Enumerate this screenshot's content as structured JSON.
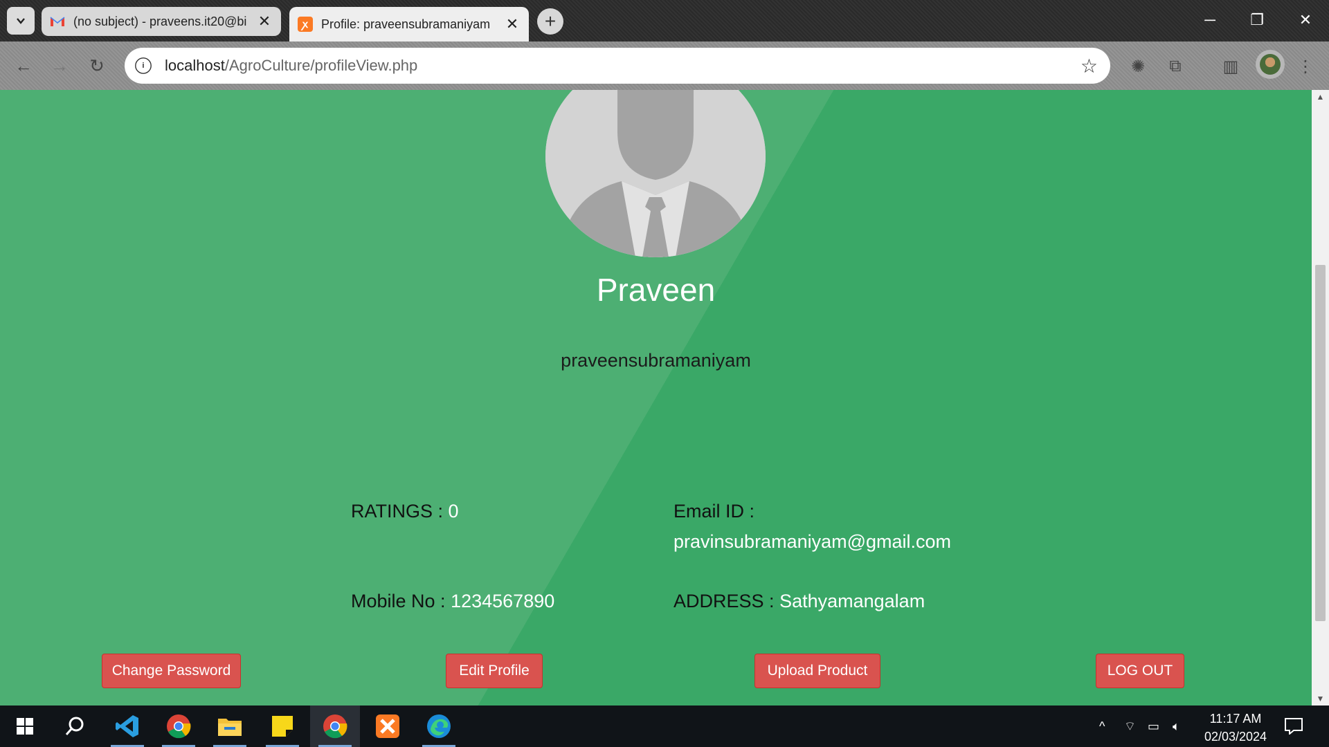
{
  "browser": {
    "tabs": [
      {
        "title": "(no subject) - praveens.it20@bi",
        "favicon": "gmail-icon",
        "active": false
      },
      {
        "title": "Profile: praveensubramaniyam",
        "favicon": "xampp-icon",
        "active": true
      }
    ],
    "url_host": "localhost",
    "url_path": "/AgroCulture/profileView.php"
  },
  "profile": {
    "name": "Praveen",
    "username": "praveensubramaniyam",
    "ratings_label": "RATINGS :",
    "ratings_value": "0",
    "email_label": "Email ID :",
    "email_value": "pravinsubramaniyam@gmail.com",
    "mobile_label": "Mobile No :",
    "mobile_value": "1234567890",
    "address_label": "ADDRESS :",
    "address_value": "Sathyamangalam"
  },
  "actions": {
    "change_password": "Change Password",
    "edit_profile": "Edit Profile",
    "upload_product": "Upload Product",
    "logout": "LOG OUT"
  },
  "colors": {
    "page_green": "#3aa867",
    "button_red": "#d9534f"
  },
  "taskbar": {
    "time": "11:17 AM",
    "date": "02/03/2024"
  }
}
